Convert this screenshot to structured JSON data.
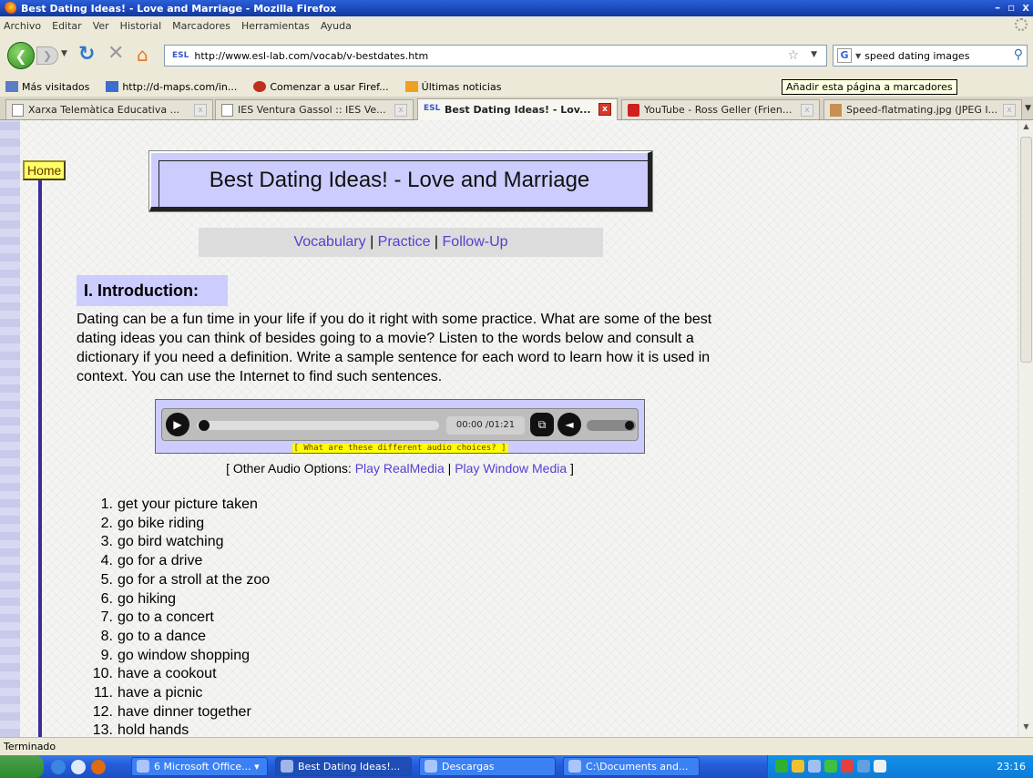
{
  "window": {
    "title": "Best Dating Ideas! - Love and Marriage - Mozilla Firefox",
    "controls": [
      "–",
      "▫",
      "x"
    ]
  },
  "menu": [
    "Archivo",
    "Editar",
    "Ver",
    "Historial",
    "Marcadores",
    "Herramientas",
    "Ayuda"
  ],
  "nav": {
    "url": "http://www.esl-lab.com/vocab/v-bestdates.htm",
    "site_icon": "ESL",
    "search_query": "speed dating images",
    "search_engine_glyph": "G"
  },
  "bookmarks": [
    {
      "label": "Más visitados",
      "icon": "most-visited-icon"
    },
    {
      "label": "http://d-maps.com/in...",
      "icon": "map-icon"
    },
    {
      "label": "Comenzar a usar Firef...",
      "icon": "firefox-icon"
    },
    {
      "label": "Últimas noticias",
      "icon": "rss-icon"
    }
  ],
  "tooltip": "Añadir esta página a marcadores",
  "tabs": [
    {
      "label": "Xarxa Telemàtica Educativa ...",
      "active": false
    },
    {
      "label": "IES Ventura Gassol :: IES Ve...",
      "active": false
    },
    {
      "label": "Best Dating Ideas! - Lov...",
      "active": true,
      "site_icon": "ESL"
    },
    {
      "label": "YouTube - Ross Geller (Frien...",
      "active": false
    },
    {
      "label": "Speed-flatmating.jpg (JPEG I...",
      "active": false
    }
  ],
  "page": {
    "home_link": "Home",
    "title": "Best Dating Ideas! - Love and Marriage",
    "nav_links": [
      "Vocabulary",
      "Practice",
      "Follow-Up"
    ],
    "nav_separator": " | ",
    "section_heading": "I. Introduction:",
    "intro_text": "Dating can be a fun time in your life if you do it right with some practice. What are some of the best dating ideas you can think of besides going to a movie? Listen to the words below and consult a dictionary if you need a definition. Write a sample sentence for each word to learn how it is used in context. You can use the Internet to find such sentences.",
    "player": {
      "time": "00:00 /01:21",
      "progress": 0,
      "volume": 1.0,
      "help_link": "[ What are these different audio choices? ]"
    },
    "audio_options": {
      "prefix": "[ Other Audio Options: ",
      "realmedia": "Play RealMedia",
      "separator": " | ",
      "windowsmedia": "Play Window Media",
      "suffix": " ]"
    },
    "vocab": [
      {
        "num": "1.",
        "text": "get your picture taken"
      },
      {
        "num": "2.",
        "text": "go bike riding"
      },
      {
        "num": "3.",
        "text": "go bird watching"
      },
      {
        "num": "4.",
        "text": "go for a drive"
      },
      {
        "num": "5.",
        "text": "go for a stroll at the zoo"
      },
      {
        "num": "6.",
        "text": "go hiking"
      },
      {
        "num": "7.",
        "text": "go to a concert"
      },
      {
        "num": "8.",
        "text": "go to a dance"
      },
      {
        "num": "9.",
        "text": "go window shopping"
      },
      {
        "num": "10.",
        "text": "have a cookout"
      },
      {
        "num": "11.",
        "text": "have a picnic"
      },
      {
        "num": "12.",
        "text": "have dinner together"
      },
      {
        "num": "13.",
        "text": "hold hands"
      }
    ]
  },
  "status": "Terminado",
  "taskbar": {
    "tasks": [
      {
        "label": "6 Microsoft Office... ▾",
        "active": false
      },
      {
        "label": "Best Dating Ideas!...",
        "active": true
      },
      {
        "label": "Descargas",
        "active": false
      },
      {
        "label": "C:\\Documents and...",
        "active": false
      }
    ],
    "clock": "23:16"
  },
  "colors": {
    "title_box": "#ccccff",
    "link": "#5a3dd0",
    "help_highlight": "#ffff00",
    "home_button": "#ffff66"
  }
}
